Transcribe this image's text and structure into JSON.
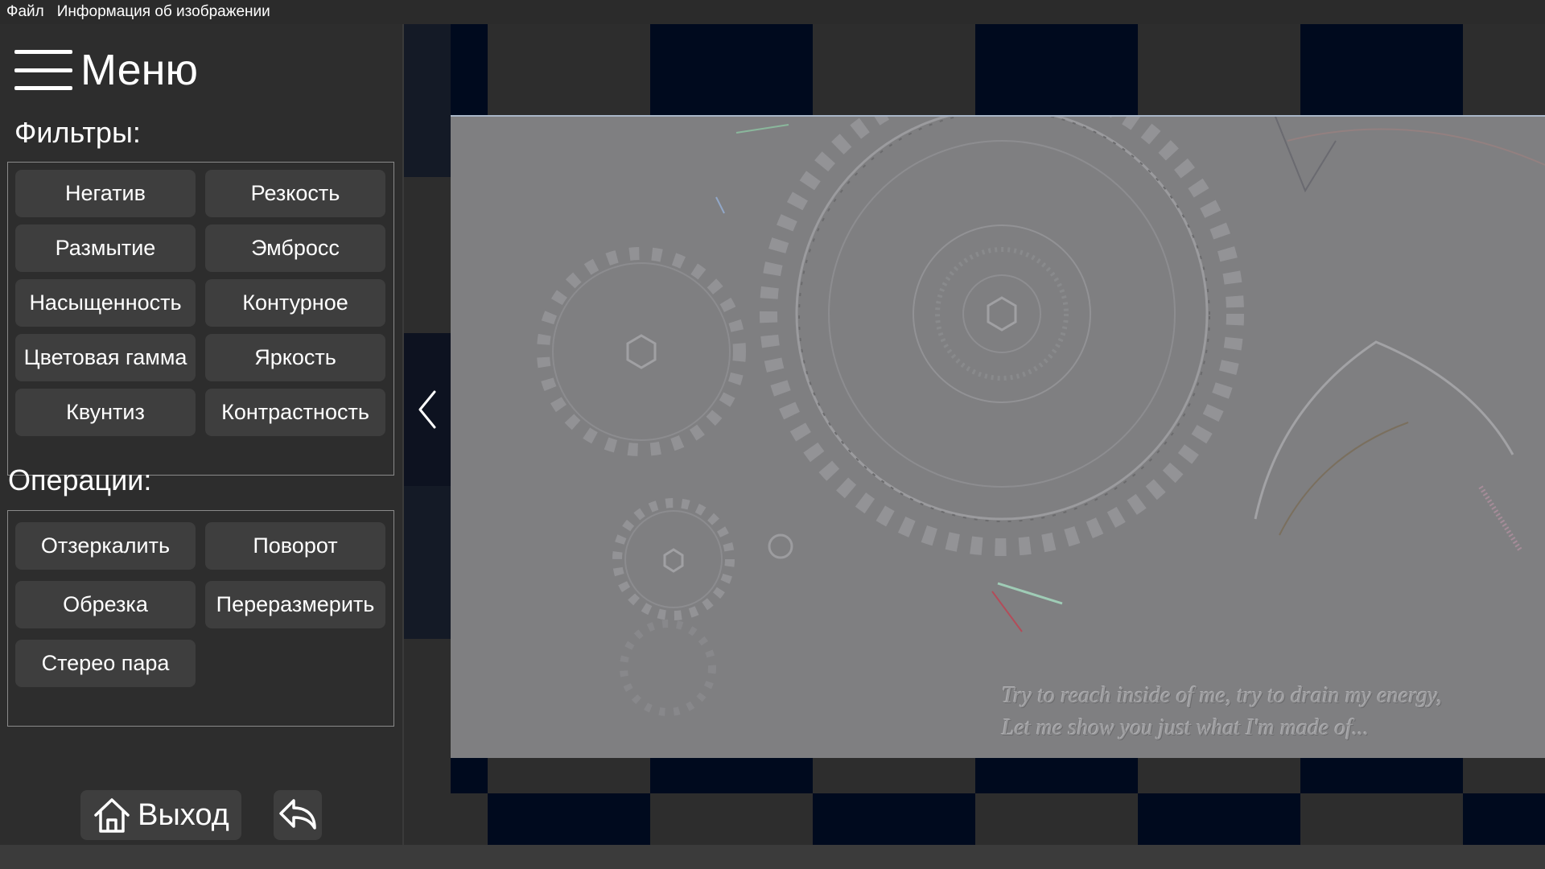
{
  "menubar": {
    "file": "Файл",
    "image_info": "Информация об изображении"
  },
  "sidebar": {
    "menu_title": "Меню",
    "filters_label": "Фильтры:",
    "filters": [
      "Негатив",
      "Резкость",
      "Размытие",
      "Эмбросс",
      "Насыщенность",
      "Контурное",
      "Цветовая гамма",
      "Яркость",
      "Квунтиз",
      "Контрастность"
    ],
    "operations_label": "Операции:",
    "operations": [
      "Отзеркалить",
      "Поворот",
      "Обрезка",
      "Переразмерить",
      "Стерео пара"
    ],
    "exit_label": "Выход"
  },
  "image": {
    "quote_line1": "Try to reach inside of me, try to drain my energy,",
    "quote_line2": "Let me show you just what I'm made of..."
  },
  "icons": {
    "menu": "hamburger-icon",
    "home": "home-icon",
    "back": "back-arrow-icon",
    "collapse": "chevron-left-icon"
  },
  "colors": {
    "background": "#2d2d2d",
    "button": "#3e3e3e",
    "checker_dark": "#000a1e",
    "checker_light": "#2d2d2d",
    "image_gray": "#7f7f81"
  }
}
